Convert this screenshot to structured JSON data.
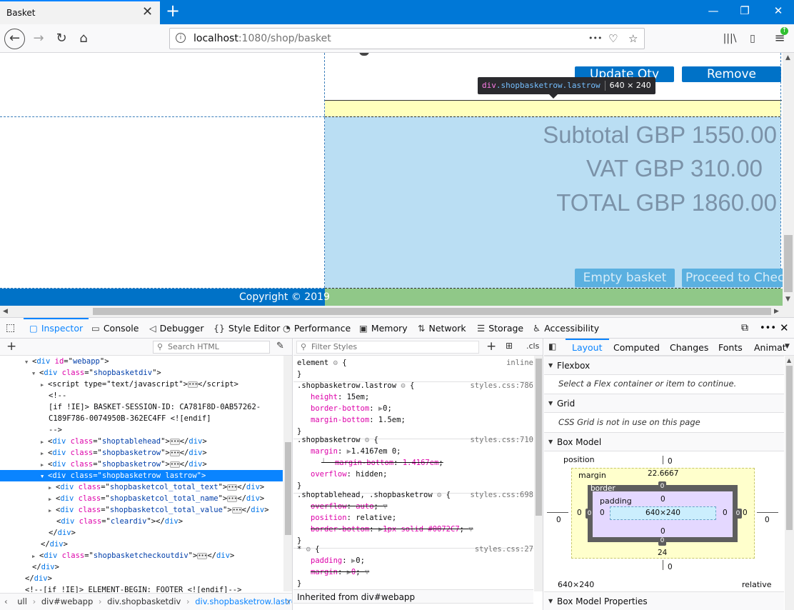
{
  "tab": {
    "title": "Basket",
    "close": "✕"
  },
  "window": {
    "new_tab": "+",
    "minimize": "—",
    "restore": "❐",
    "close": "✕"
  },
  "nav": {
    "back": "←",
    "forward": "→",
    "reload": "↻",
    "home": "⌂"
  },
  "url": {
    "host": "localhost",
    "path": ":1080/shop/basket",
    "menu": "•••"
  },
  "page": {
    "update_qty": "Update Qty",
    "remove": "Remove",
    "subtotal": "Subtotal GBP 1550.00",
    "vat": "VAT GBP 310.00",
    "total": "TOTAL GBP 1860.00",
    "empty_basket": "Empty basket",
    "proceed": "Proceed to Check",
    "copyright": "Copyright © 2019"
  },
  "tooltip": {
    "tag": "div",
    "cls": ".shopbasketrow.lastrow",
    "size": "640 × 240"
  },
  "devtools": {
    "tabs": [
      "Inspector",
      "Console",
      "Debugger",
      "Style Editor",
      "Performance",
      "Memory",
      "Network",
      "Storage",
      "Accessibility"
    ],
    "search_html": "Search HTML",
    "filter_styles": "Filter Styles",
    "cls": ".cls",
    "layout_tabs": [
      "Layout",
      "Computed",
      "Changes",
      "Fonts",
      "Animat"
    ]
  },
  "tree": {
    "webapp": "webapp",
    "basketdiv": "shopbasketdiv",
    "script_type": "text/javascript",
    "comment_open": "<!--",
    "comment_ie": "[if !IE]> BASKET-SESSION-ID: CA781F8D-0AB57262-",
    "comment_ie2": "C189F786-0074950B-362EC4FF <![endif]",
    "comment_close": "-->",
    "tablehead": "shoptablehead",
    "row": "shopbasketrow",
    "lastrow": "shopbasketrow lastrow",
    "total_text": "shopbasketcol_total_text",
    "total_name": "shopbasketcol_total_name",
    "total_value": "shopbasketcol_total_value",
    "cleardiv": "cleardiv",
    "checkoutdiv": "shopbasketcheckoutdiv",
    "footer_comment": "<!--[if !IE]> ELEMENT-BEGIN: FOOTER <![endif]-->"
  },
  "crumbs": [
    "ull",
    "div#webapp",
    "div.shopbasketdiv",
    "div.shopbasketrow.lastrow"
  ],
  "rules": {
    "element": {
      "sel": "element",
      "src": "inline"
    },
    "r1": {
      "sel": ".shopbasketrow.lastrow",
      "src": "styles.css:786",
      "p1": "height",
      "v1": "15em",
      "p2": "border-bottom",
      "v2": "0",
      "p3": "margin-bottom",
      "v3": "1.5em"
    },
    "r2": {
      "sel": ".shopbasketrow",
      "src": "styles.css:710",
      "p1": "margin",
      "v1": "1.4167em 0",
      "p2": "margin-bottom",
      "v2": "1.4167em",
      "p3": "overflow",
      "v3": "hidden"
    },
    "r3": {
      "sel": ".shoptablehead, .shopbasketrow",
      "src": "styles.css:698",
      "p1": "overflow",
      "v1": "auto",
      "p2": "position",
      "v2": "relative",
      "p3": "border-bottom",
      "v3": "1px solid #0072C7"
    },
    "r4": {
      "sel": "*",
      "src": "styles.css:27",
      "p1": "padding",
      "v1": "0",
      "p2": "margin",
      "v2": "0"
    },
    "inherited": "Inherited from div#webapp"
  },
  "layout": {
    "flexbox": "Flexbox",
    "flex_msg": "Select a Flex container or item to continue.",
    "grid": "Grid",
    "grid_msg": "CSS Grid is not in use on this page",
    "box_model": "Box Model",
    "position": "position",
    "margin": "margin",
    "border": "border",
    "padding": "padding",
    "margin_top": "22.6667",
    "margin_bottom": "24",
    "zero": "0",
    "content": "640×240",
    "dims": "640×240",
    "pos": "relative",
    "props": "Box Model Properties"
  },
  "colors": {
    "brand": "#0072c7",
    "tab_accent": "#0a84ff",
    "titlebar": "#0078d7"
  }
}
